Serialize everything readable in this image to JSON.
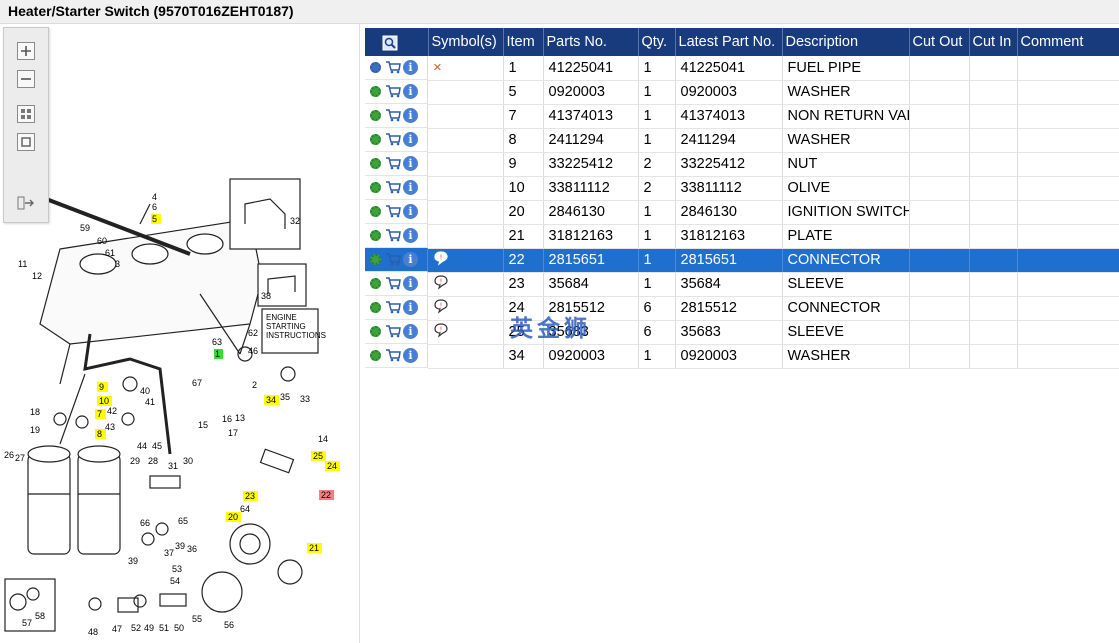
{
  "window": {
    "title": "Heater/Starter Switch (9570T016ZEHT0187)"
  },
  "zoom_toolbar": {
    "buttons": [
      "zoom-in",
      "zoom-out",
      "fit-all",
      "fit-page",
      "export"
    ]
  },
  "diagram": {
    "callouts": [
      "4",
      "6",
      "5",
      "59",
      "60",
      "61",
      "11",
      "12",
      "3",
      "32",
      "38",
      "62",
      "46",
      "63",
      "1",
      "9",
      "10",
      "7",
      "8",
      "40",
      "41",
      "42",
      "43",
      "44",
      "45",
      "18",
      "19",
      "2",
      "34",
      "35",
      "33",
      "67",
      "13",
      "14",
      "15",
      "16",
      "17",
      "25",
      "24",
      "22",
      "26",
      "27",
      "29",
      "28",
      "31",
      "30",
      "23",
      "64",
      "20",
      "21",
      "66",
      "65",
      "39",
      "37",
      "36",
      "53",
      "54",
      "55",
      "56",
      "57",
      "58",
      "48",
      "47",
      "52",
      "49",
      "51",
      "50"
    ],
    "label_box": [
      "ENGINE",
      "STARTING",
      "INSTRUCTIONS"
    ]
  },
  "grid": {
    "columns": [
      "Symbol(s)",
      "Item",
      "Parts No.",
      "Qty.",
      "Latest Part No.",
      "Description",
      "Cut Out",
      "Cut In",
      "Comment"
    ],
    "rows": [
      {
        "item": "1",
        "parts_no": "41225041",
        "qty": "1",
        "latest": "41225041",
        "desc": "FUEL PIPE",
        "symbol": "×",
        "gear": "blue"
      },
      {
        "item": "5",
        "parts_no": "0920003",
        "qty": "1",
        "latest": "0920003",
        "desc": "WASHER",
        "symbol": "",
        "gear": "green"
      },
      {
        "item": "7",
        "parts_no": "41374013",
        "qty": "1",
        "latest": "41374013",
        "desc": "NON RETURN VALVE",
        "symbol": "",
        "gear": "green"
      },
      {
        "item": "8",
        "parts_no": "2411294",
        "qty": "1",
        "latest": "2411294",
        "desc": "WASHER",
        "symbol": "",
        "gear": "green"
      },
      {
        "item": "9",
        "parts_no": "33225412",
        "qty": "2",
        "latest": "33225412",
        "desc": "NUT",
        "symbol": "",
        "gear": "green"
      },
      {
        "item": "10",
        "parts_no": "33811112",
        "qty": "2",
        "latest": "33811112",
        "desc": "OLIVE",
        "symbol": "",
        "gear": "green"
      },
      {
        "item": "20",
        "parts_no": "2846130",
        "qty": "1",
        "latest": "2846130",
        "desc": "IGNITION SWITCH",
        "symbol": "",
        "gear": "green"
      },
      {
        "item": "21",
        "parts_no": "31812163",
        "qty": "1",
        "latest": "31812163",
        "desc": "PLATE",
        "symbol": "",
        "gear": "green"
      },
      {
        "item": "22",
        "parts_no": "2815651",
        "qty": "1",
        "latest": "2815651",
        "desc": "CONNECTOR",
        "symbol": "!",
        "gear": "green",
        "selected": true
      },
      {
        "item": "23",
        "parts_no": "35684",
        "qty": "1",
        "latest": "35684",
        "desc": "SLEEVE",
        "symbol": "!",
        "gear": "green"
      },
      {
        "item": "24",
        "parts_no": "2815512",
        "qty": "6",
        "latest": "2815512",
        "desc": "CONNECTOR",
        "symbol": "!",
        "gear": "green"
      },
      {
        "item": "25",
        "parts_no": "35683",
        "qty": "6",
        "latest": "35683",
        "desc": "SLEEVE",
        "symbol": "!",
        "gear": "green"
      },
      {
        "item": "34",
        "parts_no": "0920003",
        "qty": "1",
        "latest": "0920003",
        "desc": "WASHER",
        "symbol": "",
        "gear": "green"
      }
    ]
  },
  "watermark": "英金狮",
  "colors": {
    "header_bg": "#173b7d",
    "selected_bg": "#1f6fcf",
    "highlight_yellow": "#ffff00",
    "highlight_green": "#33dd33",
    "highlight_red": "#f08080"
  }
}
